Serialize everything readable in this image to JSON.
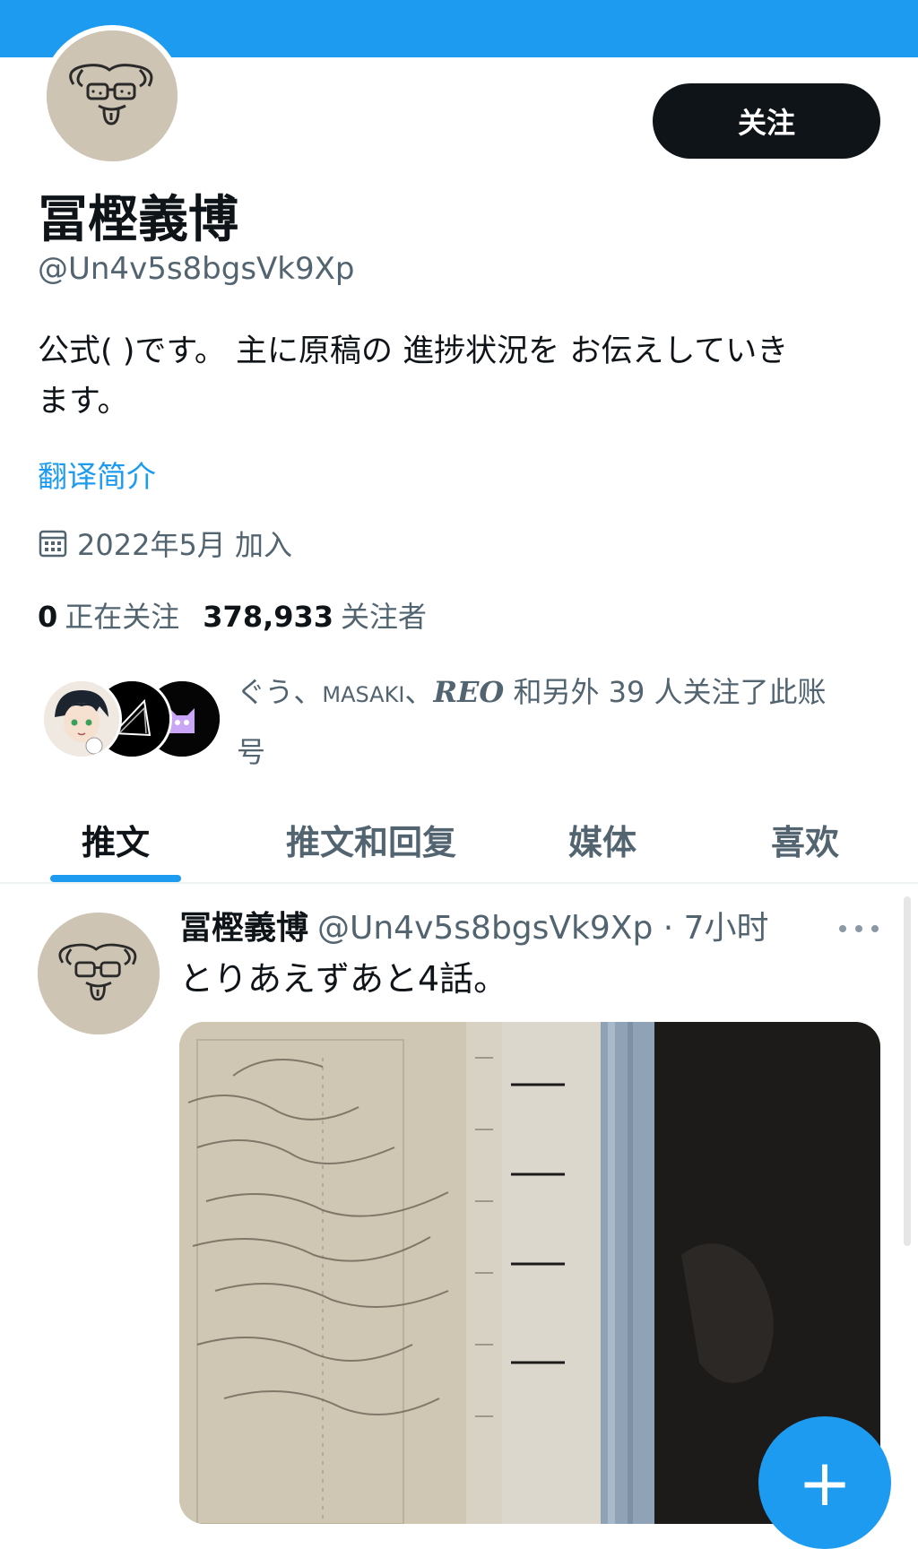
{
  "profile": {
    "follow_label": "关注",
    "display_name": "冨樫義博",
    "handle": "@Un4v5s8bgsVk9Xp",
    "bio_line1": "公式( )です。 主に原稿の 進捗状況を お伝えしていき",
    "bio_line2": "ます。",
    "translate_label": "翻译简介",
    "joined": "2022年5月 加入",
    "following_count": "0",
    "following_label": "正在关注",
    "followers_count": "378,933",
    "followers_label": "关注者",
    "followed_by": {
      "name1": "ぐう、",
      "name2": "MASAKI",
      "sep": "、",
      "name3": "REO",
      "suffix": " 和另外 39 人关注了此账",
      "suffix2": "号"
    }
  },
  "tabs": [
    {
      "label": "推文",
      "active": true
    },
    {
      "label": "推文和回复",
      "active": false
    },
    {
      "label": "媒体",
      "active": false
    },
    {
      "label": "喜欢",
      "active": false
    }
  ],
  "tweet": {
    "name": "冨樫義博",
    "meta": "@Un4v5s8bgsVk9Xp · 7小时",
    "text": "とりあえずあと4話。"
  },
  "colors": {
    "accent": "#1d9bf0",
    "text_primary": "#0f1419",
    "text_secondary": "#536471",
    "button_dark": "#0f1419"
  },
  "icons": {
    "calendar": "calendar-icon",
    "more": "more-icon",
    "compose": "compose-plus-icon"
  }
}
